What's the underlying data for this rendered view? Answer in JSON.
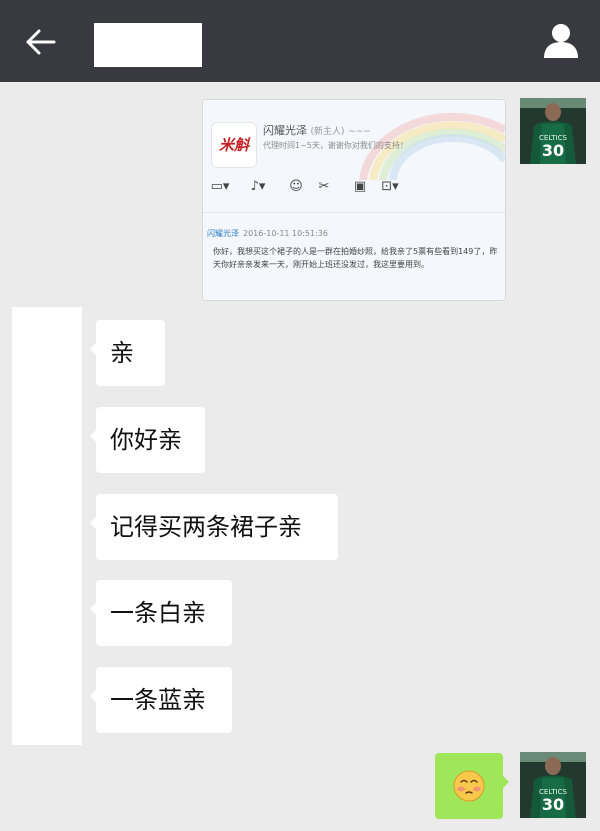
{
  "header": {
    "title": ""
  },
  "shared_card": {
    "logo_text": "米斛",
    "shop_name": "闪耀光泽",
    "shop_tag": "(新主人)",
    "shop_suffix": "~~~",
    "description": "代理时间1~5天，谢谢你对我们的支持！",
    "sender": "闪耀光泽",
    "timestamp": "2016-10-11 10:51:36",
    "message": "你好，我想买这个裙子的人是一群在拍婚纱照，给我亲了5票有些看到149了，昨天你好亲亲发来一天，刚开始上班还没发过，我这里要用到。"
  },
  "messages": [
    {
      "text": "亲"
    },
    {
      "text": "你好亲"
    },
    {
      "text": "记得买两条裙子亲"
    },
    {
      "text": "一条白亲"
    },
    {
      "text": "一条蓝亲"
    }
  ],
  "avatar": {
    "jersey_number": "30"
  },
  "colors": {
    "topbar": "#393a3f",
    "background": "#ebebeb",
    "sent_bubble": "#9fe658",
    "received_bubble": "#ffffff"
  }
}
